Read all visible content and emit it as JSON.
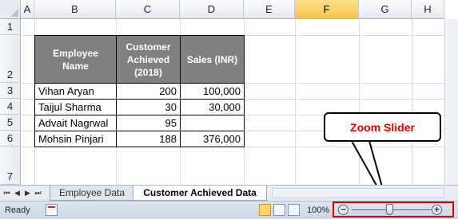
{
  "columns": [
    "A",
    "B",
    "C",
    "D",
    "E",
    "F",
    "G",
    "H"
  ],
  "selected_column": "F",
  "rows": [
    "1",
    "2",
    "3",
    "4",
    "5",
    "6",
    "7"
  ],
  "table": {
    "headers": [
      [
        "Employee",
        "Name"
      ],
      [
        "Customer",
        "Achieved",
        "(2018)"
      ],
      [
        "Sales (INR)"
      ]
    ],
    "rows": [
      [
        "Vihan Aryan",
        "200",
        "100,000"
      ],
      [
        "Taijul Sharma",
        "30",
        "30,000"
      ],
      [
        "Advait Nagrwal",
        "95",
        ""
      ],
      [
        "Mohsin Pinjari",
        "188",
        "376,000"
      ]
    ]
  },
  "sheet_tabs": [
    {
      "label": "Employee Data",
      "active": false
    },
    {
      "label": "Customer Achieved Data",
      "active": true
    }
  ],
  "status": {
    "ready": "Ready",
    "zoom": "100%"
  },
  "callout": {
    "text": "Zoom Slider"
  },
  "icons": {
    "nav_first": "nav-first-icon",
    "nav_prev": "nav-prev-icon",
    "nav_next": "nav-next-icon",
    "nav_last": "nav-last-icon",
    "zoom_out": "minus-icon",
    "zoom_in": "plus-icon"
  },
  "colors": {
    "header_fill": "#808080",
    "callout_text": "#e00000",
    "highlight": "#e00000",
    "selected_col": "#f8c34b"
  }
}
